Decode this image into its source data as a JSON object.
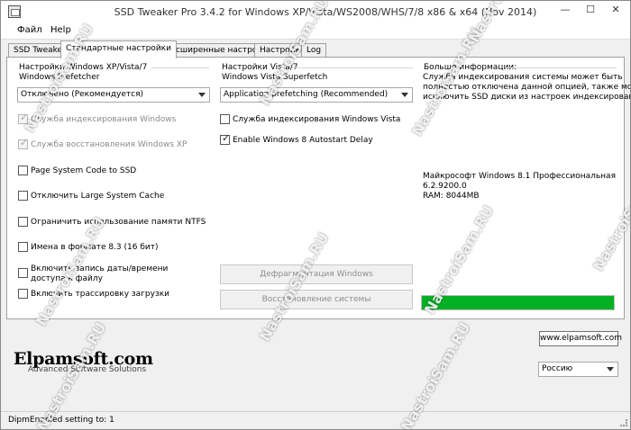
{
  "window": {
    "title": "SSD Tweaker Pro 3.4.2 for Windows XP/Vista/WS2008/WHS/7/8 x86 & x64 (Nov 2014)",
    "min_glyph": "—",
    "max_glyph": "☐",
    "close_glyph": "✕"
  },
  "menu": {
    "file": "Файл",
    "help": "Help"
  },
  "tabs": [
    "SSD Tweaker",
    "Стандартные настройки",
    "Расширенные настройки",
    "Настройки",
    "Log"
  ],
  "left": {
    "header": "Настройки Windows XP/Vista/7",
    "prefetcher_label": "Windows Prefetcher",
    "prefetcher_value": "Отключено (Рекомендуется)",
    "options": [
      {
        "label": "Служба индексирования Windows",
        "checked": true,
        "disabled": true
      },
      {
        "label": "Служба восстановления Windows XP",
        "checked": true,
        "disabled": true
      },
      {
        "label": "Page System Code to SSD",
        "checked": false,
        "disabled": false
      },
      {
        "label": "Отключить Large System Cache",
        "checked": false,
        "disabled": false
      },
      {
        "label": "Ограничить использование памяти NTFS",
        "checked": false,
        "disabled": false
      },
      {
        "label": "Имена в формате 8.3 (16 бит)",
        "checked": false,
        "disabled": false
      },
      {
        "label": "Включить запись даты/времени доступа к файлу",
        "checked": false,
        "disabled": false
      },
      {
        "label": "Включить трассировку загрузки",
        "checked": false,
        "disabled": false
      }
    ]
  },
  "middle": {
    "header": "Настройки Vista/7",
    "superfetch_label": "Windows Vista Superfetch",
    "superfetch_value": "Application prefetching (Recommended)",
    "options": [
      {
        "label": "Служба индексирования Windows Vista",
        "checked": false,
        "disabled": false
      },
      {
        "label": "Enable Windows 8 Autostart Delay",
        "checked": true,
        "disabled": false
      }
    ],
    "defrag_button": "Дефрагментация Windows",
    "restore_button": "Восстановление системы"
  },
  "right": {
    "header": "Больше информации:",
    "info_line1": "Служба индексирования системы может быть",
    "info_line2": "полностью отключена данной опцией, также можно",
    "info_line3": "исключить SSD диски из настроек индексирования.",
    "os_name": "Майкрософт Windows 8.1 Профессиональная",
    "os_version": "6.2.9200.0",
    "ram": "RAM: 8044MB",
    "progress": 1.0
  },
  "colors": {
    "progress": "#06b025"
  },
  "bottom": {
    "website_button": "www.elpamsoft.com",
    "logo": "Elpamsoft.com",
    "logo_tagline": "Advanced Software Solutions",
    "language_value": "Россию"
  },
  "status": "DipmEnabled setting to: 1",
  "watermark": "NastroiSam.RU"
}
